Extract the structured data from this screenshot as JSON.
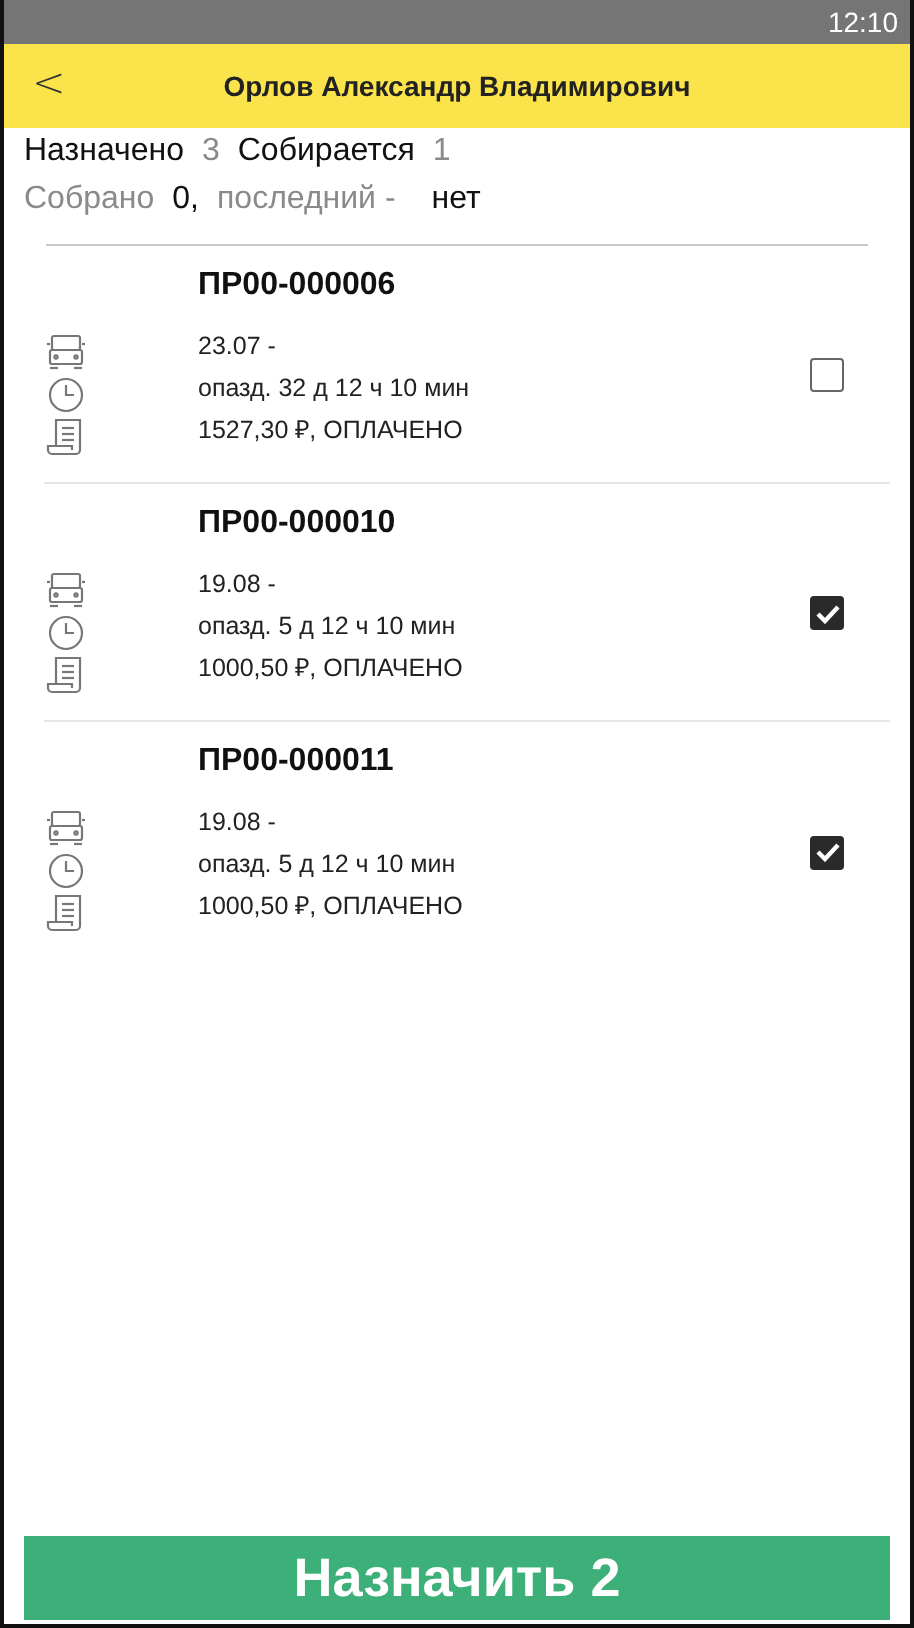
{
  "status_bar": {
    "time": "12:10"
  },
  "header": {
    "back": "<",
    "title": "Орлов Александр Владимирович"
  },
  "summary": {
    "assigned_label": "Назначено",
    "assigned_count": "3",
    "collecting_label": "Собирается",
    "collecting_count": "1",
    "collected_label": "Собрано",
    "collected_count": "0,",
    "last_label": "последний -",
    "last_value": "нет"
  },
  "orders": [
    {
      "number": "ПР00-000006",
      "date": "23.07  -",
      "delay": "опазд.  32 д 12 ч 10 мин",
      "amount": "1527,30 ₽, ОПЛАЧЕНО",
      "checked": false
    },
    {
      "number": "ПР00-000010",
      "date": "19.08  -",
      "delay": "опазд.  5 д 12 ч 10 мин",
      "amount": "1000,50 ₽, ОПЛАЧЕНО",
      "checked": true
    },
    {
      "number": "ПР00-000011",
      "date": "19.08  -",
      "delay": "опазд.  5 д 12 ч 10 мин",
      "amount": "1000,50 ₽, ОПЛАЧЕНО",
      "checked": true
    }
  ],
  "assign_button": "Назначить 2"
}
